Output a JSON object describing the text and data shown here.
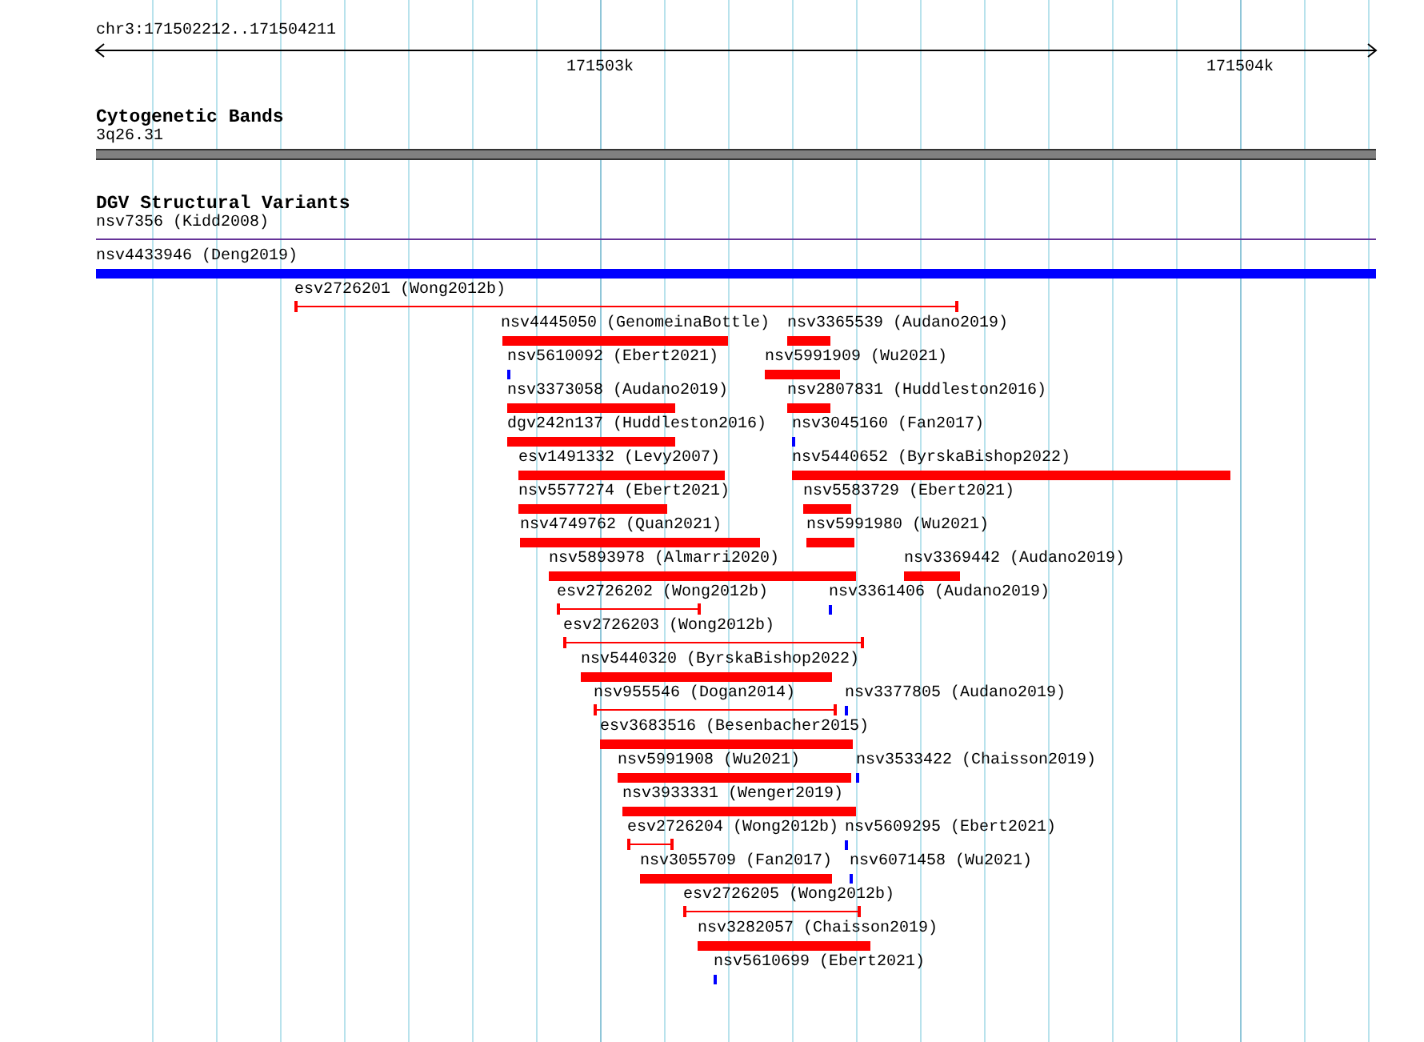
{
  "ruler": {
    "location": "chr3:171502212..171504211",
    "ticks": [
      "171503k",
      "171504k"
    ]
  },
  "tracks": [
    {
      "title": "Cytogenetic Bands",
      "features": [
        {
          "label": "3q26.31",
          "kind": "band",
          "color": "#808080"
        }
      ]
    },
    {
      "title": "DGV Structural Variants",
      "features": [
        {
          "label": "nsv7356 (Kidd2008)",
          "kind": "line",
          "color": "#663399"
        },
        {
          "label": "nsv4433946 (Deng2019)",
          "kind": "bar",
          "color": "#0000ff"
        },
        {
          "label": "esv2726201 (Wong2012b)",
          "kind": "range",
          "color": "#ff0000"
        },
        {
          "label": "nsv4445050 (GenomeinaBottle)",
          "kind": "bar",
          "color": "#ff0000"
        },
        {
          "label": "nsv3365539 (Audano2019)",
          "kind": "bar",
          "color": "#ff0000"
        },
        {
          "label": "nsv5610092 (Ebert2021)",
          "kind": "point",
          "color": "#0000ff"
        },
        {
          "label": "nsv5991909 (Wu2021)",
          "kind": "bar",
          "color": "#ff0000"
        },
        {
          "label": "nsv3373058 (Audano2019)",
          "kind": "bar",
          "color": "#ff0000"
        },
        {
          "label": "nsv2807831 (Huddleston2016)",
          "kind": "bar",
          "color": "#ff0000"
        },
        {
          "label": "dgv242n137 (Huddleston2016)",
          "kind": "bar",
          "color": "#ff0000"
        },
        {
          "label": "nsv3045160 (Fan2017)",
          "kind": "point",
          "color": "#0000ff"
        },
        {
          "label": "esv1491332 (Levy2007)",
          "kind": "bar",
          "color": "#ff0000"
        },
        {
          "label": "nsv5440652 (ByrskaBishop2022)",
          "kind": "bar",
          "color": "#ff0000"
        },
        {
          "label": "nsv5577274 (Ebert2021)",
          "kind": "bar",
          "color": "#ff0000"
        },
        {
          "label": "nsv5583729 (Ebert2021)",
          "kind": "bar",
          "color": "#ff0000"
        },
        {
          "label": "nsv4749762 (Quan2021)",
          "kind": "bar",
          "color": "#ff0000"
        },
        {
          "label": "nsv5991980 (Wu2021)",
          "kind": "bar",
          "color": "#ff0000"
        },
        {
          "label": "nsv5893978 (Almarri2020)",
          "kind": "bar",
          "color": "#ff0000"
        },
        {
          "label": "nsv3369442 (Audano2019)",
          "kind": "bar",
          "color": "#ff0000"
        },
        {
          "label": "esv2726202 (Wong2012b)",
          "kind": "range",
          "color": "#ff0000"
        },
        {
          "label": "nsv3361406 (Audano2019)",
          "kind": "point",
          "color": "#0000ff"
        },
        {
          "label": "esv2726203 (Wong2012b)",
          "kind": "range",
          "color": "#ff0000"
        },
        {
          "label": "nsv5440320 (ByrskaBishop2022)",
          "kind": "bar",
          "color": "#ff0000"
        },
        {
          "label": "nsv955546 (Dogan2014)",
          "kind": "range",
          "color": "#ff0000"
        },
        {
          "label": "nsv3377805 (Audano2019)",
          "kind": "point",
          "color": "#0000ff"
        },
        {
          "label": "esv3683516 (Besenbacher2015)",
          "kind": "bar",
          "color": "#ff0000"
        },
        {
          "label": "nsv5991908 (Wu2021)",
          "kind": "bar",
          "color": "#ff0000"
        },
        {
          "label": "nsv3533422 (Chaisson2019)",
          "kind": "point",
          "color": "#0000ff"
        },
        {
          "label": "nsv3933331 (Wenger2019)",
          "kind": "bar",
          "color": "#ff0000"
        },
        {
          "label": "esv2726204 (Wong2012b)",
          "kind": "range",
          "color": "#ff0000"
        },
        {
          "label": "nsv5609295 (Ebert2021)",
          "kind": "point",
          "color": "#0000ff"
        },
        {
          "label": "nsv3055709 (Fan2017)",
          "kind": "bar",
          "color": "#ff0000"
        },
        {
          "label": "nsv6071458 (Wu2021)",
          "kind": "point",
          "color": "#0000ff"
        },
        {
          "label": "esv2726205 (Wong2012b)",
          "kind": "range",
          "color": "#ff0000"
        },
        {
          "label": "nsv3282057 (Chaisson2019)",
          "kind": "bar",
          "color": "#ff0000"
        },
        {
          "label": "nsv5610699 (Ebert2021)",
          "kind": "point",
          "color": "#0000ff"
        }
      ]
    }
  ]
}
